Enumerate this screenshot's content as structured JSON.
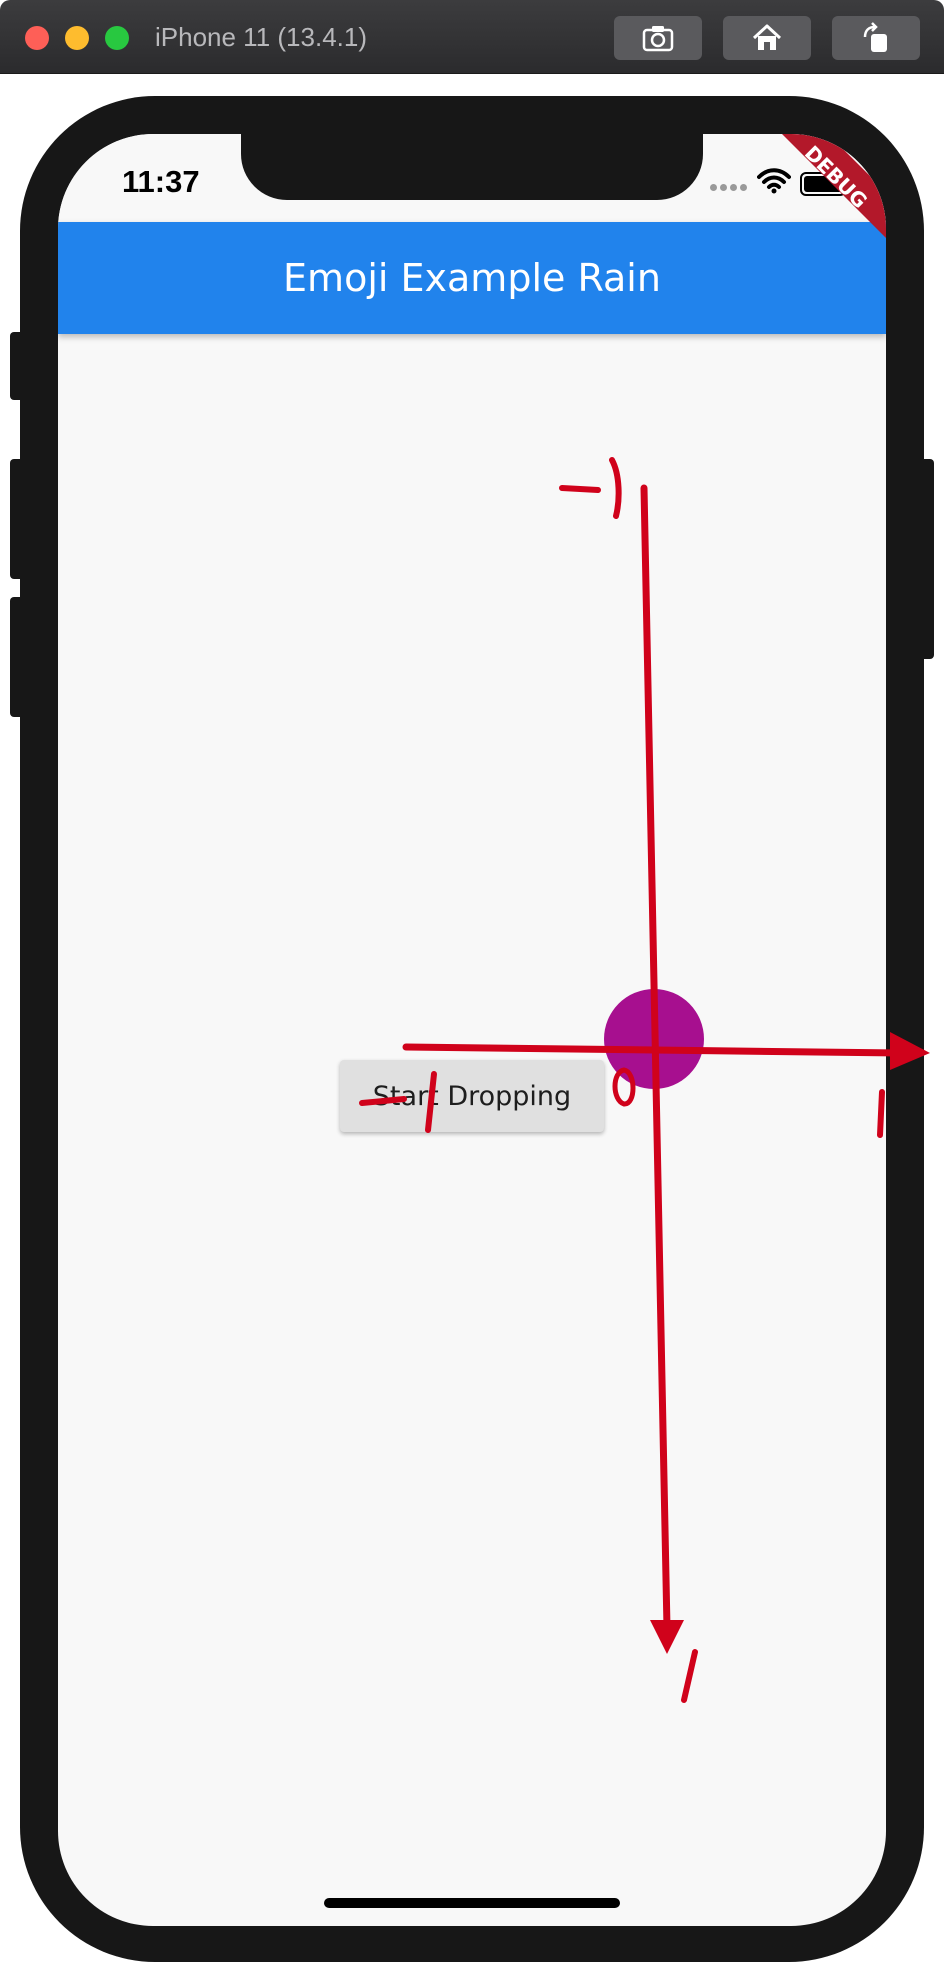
{
  "simulator": {
    "title": "iPhone 11 (13.4.1)",
    "buttons": {
      "screenshot_icon": "camera-icon",
      "home_icon": "home-icon",
      "rotate_icon": "rotate-icon"
    }
  },
  "status_bar": {
    "time": "11:37",
    "icons": [
      "signal-icon",
      "wifi-icon",
      "battery-icon"
    ]
  },
  "debug_banner": {
    "label": "DEBUG"
  },
  "app_bar": {
    "title": "Emoji Example Rain",
    "color": "#2183ec"
  },
  "body": {
    "start_button_label": "Start Dropping",
    "dot_color": "#a70f8f"
  },
  "annotations": {
    "color": "#d0021b",
    "y_axis_top_label": "-1",
    "y_axis_bottom_label": "1",
    "x_axis_left_label": "-1",
    "x_axis_right_label": "1",
    "origin_label": "0"
  }
}
